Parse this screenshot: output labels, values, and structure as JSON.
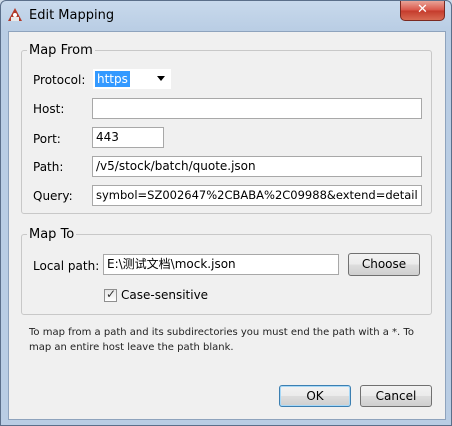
{
  "window": {
    "title": "Edit Mapping",
    "close_glyph": "✕"
  },
  "map_from": {
    "legend": "Map From",
    "protocol_label": "Protocol:",
    "protocol_value": "https",
    "host_label": "Host:",
    "host_value": "",
    "port_label": "Port:",
    "port_value": "443",
    "path_label": "Path:",
    "path_value": "/v5/stock/batch/quote.json",
    "query_label": "Query:",
    "query_value": "symbol=SZ002647%2CBABA%2C09988&extend=detail"
  },
  "map_to": {
    "legend": "Map To",
    "local_path_label": "Local path:",
    "local_path_value": "E:\\测试文档\\mock.json",
    "choose_label": "Choose",
    "case_sensitive_label": "Case-sensitive",
    "case_sensitive_checked": true
  },
  "note": "To map from a path and its subdirectories you must end the path with a *. To map an entire host leave the path blank.",
  "buttons": {
    "ok": "OK",
    "cancel": "Cancel"
  }
}
